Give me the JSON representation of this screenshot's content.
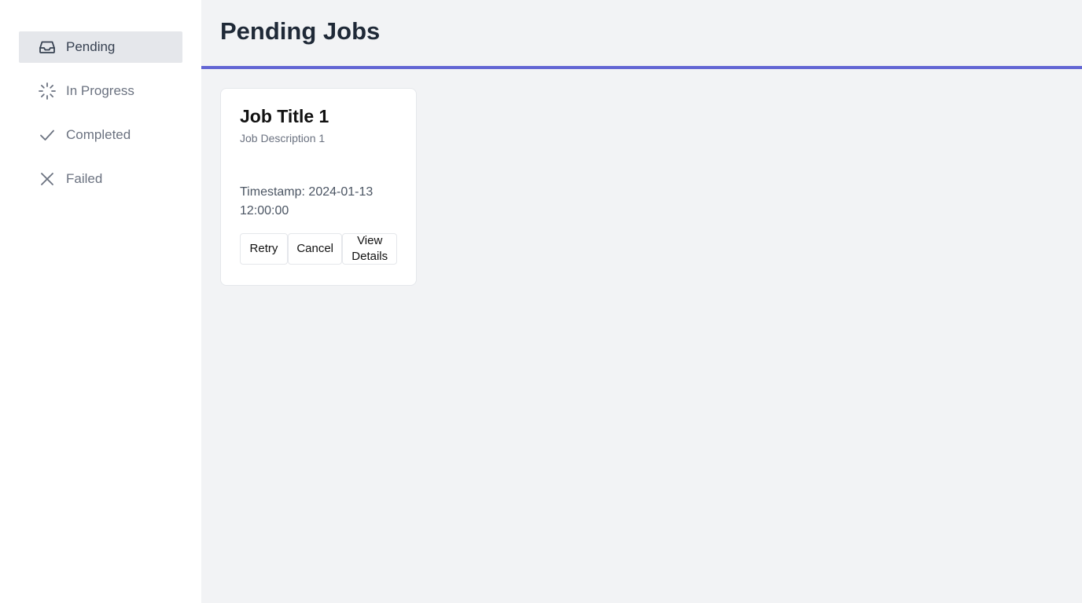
{
  "sidebar": {
    "items": [
      {
        "label": "Pending",
        "icon": "inbox-icon",
        "active": true
      },
      {
        "label": "In Progress",
        "icon": "spinner-icon",
        "active": false
      },
      {
        "label": "Completed",
        "icon": "check-icon",
        "active": false
      },
      {
        "label": "Failed",
        "icon": "x-icon",
        "active": false
      }
    ]
  },
  "header": {
    "title": "Pending Jobs"
  },
  "colors": {
    "accent": "#6366d4",
    "active_bg": "#e5e7eb",
    "page_bg": "#f2f3f5"
  },
  "jobs": [
    {
      "title": "Job Title 1",
      "description": "Job Description 1",
      "timestamp": "Timestamp: 2024-01-13 12:00:00",
      "actions": {
        "retry": "Retry",
        "cancel": "Cancel",
        "details": "View Details"
      }
    }
  ]
}
